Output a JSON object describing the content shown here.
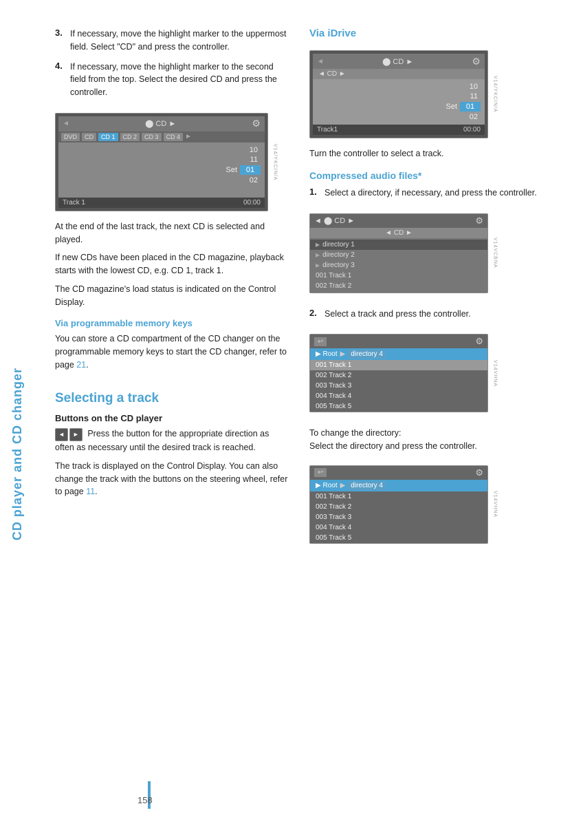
{
  "sidebar": {
    "text": "CD player and CD changer"
  },
  "left_col": {
    "step3": {
      "num": "3.",
      "text": "If necessary, move the highlight marker to the uppermost field. Select \"CD\" and press the controller."
    },
    "step4": {
      "num": "4.",
      "text": "If necessary, move the highlight marker to the second field from the top. Select the desired CD and press the controller."
    },
    "cd_screen": {
      "topbar_label": "CD",
      "cd_buttons": [
        "DVD",
        "CD",
        "CD 1",
        "CD 2",
        "CD 3",
        "CD 4"
      ],
      "active_cd": "CD 1",
      "rows": [
        "10",
        "11"
      ],
      "set_label": "Set",
      "set_value": "01",
      "row_02": "02",
      "track_label": "Track 1",
      "time": "00:00"
    },
    "para1": "At the end of the last track, the next CD is selected and played.",
    "para2": "If new CDs have been placed in the CD magazine, playback starts with the lowest CD, e.g. CD 1, track 1.",
    "para3": "The CD magazine's load status is indicated on the Control Display.",
    "memory_keys_heading": "Via programmable memory keys",
    "memory_keys_text": "You can store a CD compartment of the CD changer on the programmable memory keys to start the CD changer, refer to page 21.",
    "selecting_track_heading": "Selecting a track",
    "buttons_cd_heading": "Buttons on the CD player",
    "btn_label_left": "◄",
    "btn_label_right": "►",
    "buttons_text": "Press the button for the appropriate direction as often as necessary until the desired track is reached.",
    "track_display_text": "The track is displayed on the Control Display. You can also change the track with the buttons on the steering wheel, refer to page 11.",
    "page_ref_11": "11"
  },
  "right_col": {
    "via_idrive_heading": "Via iDrive",
    "idrive_screen": {
      "topbar_label": "CD",
      "sub_label": "CD",
      "rows": [
        "10",
        "11"
      ],
      "set_label": "Set",
      "set_value": "01",
      "row_02": "02",
      "track_label": "Track1",
      "time": "00:00"
    },
    "idrive_text": "Turn the controller to select a track.",
    "compressed_heading": "Compressed audio files*",
    "compressed_step1": {
      "num": "1.",
      "text": "Select a directory, if necessary, and press the controller."
    },
    "dir_screen": {
      "topbar_label": "CD",
      "sub_label": "CD",
      "directories": [
        "▶ directory 1",
        "▶ directory 2",
        "▶ directory 3",
        "001 Track 1",
        "002 Track 2"
      ]
    },
    "compressed_step2": {
      "num": "2.",
      "text": "Select a track and press the controller."
    },
    "track_screen": {
      "breadcrumb": [
        "Root",
        "directory 4"
      ],
      "tracks": [
        "001 Track 1",
        "002 Track 2",
        "003 Track 3",
        "004 Track 4",
        "005 Track 5"
      ]
    },
    "change_dir_text": "To change the directory:",
    "change_dir_text2": "Select the directory and press the controller.",
    "track_screen2": {
      "breadcrumb": [
        "Root",
        "directory 4"
      ],
      "tracks": [
        "001 Track 1",
        "002 Track 2",
        "003 Track 3",
        "004 Track 4",
        "005 Track 5"
      ]
    }
  },
  "page_number": "158"
}
